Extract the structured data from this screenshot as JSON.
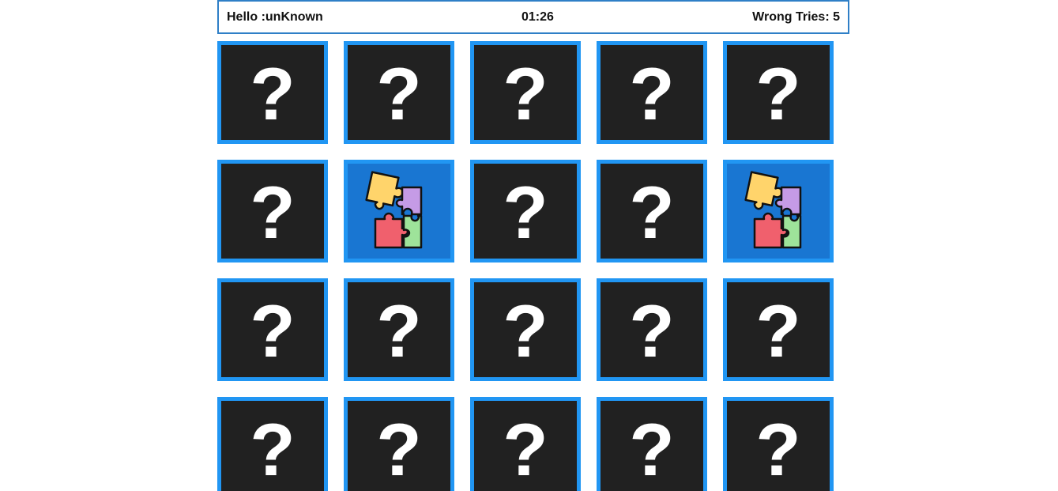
{
  "header": {
    "greeting": "Hello :unKnown",
    "timer": "01:26",
    "wrong_tries": "Wrong Tries: 5"
  },
  "board": {
    "rows": 4,
    "columns": 5,
    "hidden_symbol": "?",
    "cards": [
      {
        "state": "hidden"
      },
      {
        "state": "hidden"
      },
      {
        "state": "hidden"
      },
      {
        "state": "hidden"
      },
      {
        "state": "hidden"
      },
      {
        "state": "hidden"
      },
      {
        "state": "flipped",
        "icon": "puzzle-pieces-icon"
      },
      {
        "state": "hidden"
      },
      {
        "state": "hidden"
      },
      {
        "state": "flipped",
        "icon": "puzzle-pieces-icon"
      },
      {
        "state": "hidden"
      },
      {
        "state": "hidden"
      },
      {
        "state": "hidden"
      },
      {
        "state": "hidden"
      },
      {
        "state": "hidden"
      },
      {
        "state": "hidden"
      },
      {
        "state": "hidden"
      },
      {
        "state": "hidden"
      },
      {
        "state": "hidden"
      },
      {
        "state": "hidden"
      }
    ]
  },
  "colors": {
    "card_back": "#212121",
    "card_border": "#2196f3",
    "card_face": "#1976d2",
    "header_border": "#2f7fc7"
  }
}
